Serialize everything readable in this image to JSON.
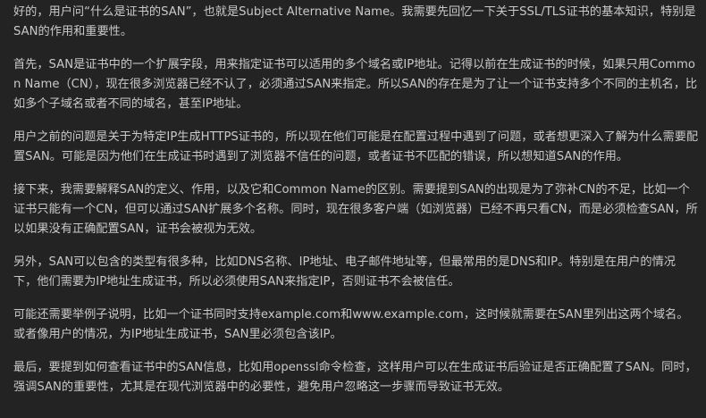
{
  "paragraphs": [
    "好的，用户问“什么是证书的SAN”，也就是Subject Alternative Name。我需要先回忆一下关于SSL/TLS证书的基本知识，特别是SAN的作用和重要性。",
    "首先，SAN是证书中的一个扩展字段，用来指定证书可以适用的多个域名或IP地址。记得以前在生成证书的时候，如果只用Common Name（CN），现在很多浏览器已经不认了，必须通过SAN来指定。所以SAN的存在是为了让一个证书支持多个不同的主机名，比如多个子域名或者不同的域名，甚至IP地址。",
    "用户之前的问题是关于为特定IP生成HTTPS证书的，所以现在他们可能是在配置过程中遇到了问题，或者想更深入了解为什么需要配置SAN。可能是因为他们在生成证书时遇到了浏览器不信任的问题，或者证书不匹配的错误，所以想知道SAN的作用。",
    "接下来，我需要解释SAN的定义、作用，以及它和Common Name的区别。需要提到SAN的出现是为了弥补CN的不足，比如一个证书只能有一个CN，但可以通过SAN扩展多个名称。同时，现在很多客户端（如浏览器）已经不再只看CN，而是必须检查SAN，所以如果没有正确配置SAN，证书会被视为无效。",
    "另外，SAN可以包含的类型有很多种，比如DNS名称、IP地址、电子邮件地址等，但最常用的是DNS和IP。特别是在用户的情况下，他们需要为IP地址生成证书，所以必须使用SAN来指定IP，否则证书不会被信任。",
    "可能还需要举例子说明，比如一个证书同时支持example.com和www.example.com，这时候就需要在SAN里列出这两个域名。或者像用户的情况，为IP地址生成证书，SAN里必须包含该IP。",
    "最后，要提到如何查看证书中的SAN信息，比如用openssl命令检查，这样用户可以在生成证书后验证是否正确配置了SAN。同时，强调SAN的重要性，尤其是在现代浏览器中的必要性，避免用户忽略这一步骤而导致证书无效。"
  ]
}
